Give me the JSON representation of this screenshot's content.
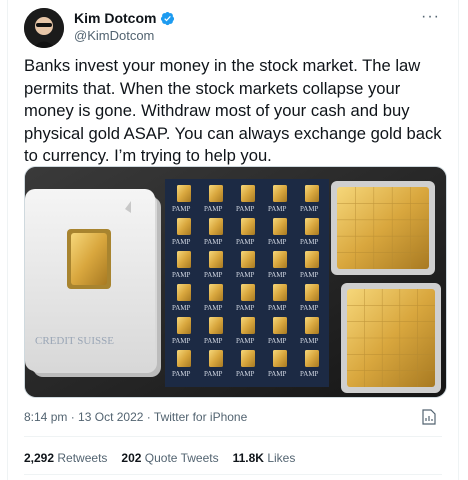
{
  "author": {
    "name": "Kim Dotcom",
    "handle": "@KimDotcom",
    "verified_icon": "verified-badge-icon"
  },
  "more_label": "···",
  "tweet": {
    "text": "Banks invest your money in the stock market. The law permits that. When the stock markets collapse your money is gone. Withdraw most of your cash and buy physical gold ASAP. You can always exchange gold back to currency. I’m trying to help you."
  },
  "media": {
    "brand_text": "CREDIT SUISSE",
    "bar_stamp": "PAMP"
  },
  "meta": {
    "time": "8:14 pm",
    "date": "13 Oct 2022",
    "source": "Twitter for iPhone",
    "separator": "·"
  },
  "stats": {
    "retweets_count": "2,292",
    "retweets_label": "Retweets",
    "quotes_count": "202",
    "quotes_label": "Quote Tweets",
    "likes_count": "11.8K",
    "likes_label": "Likes"
  },
  "colors": {
    "verified": "#1d9bf0",
    "gold": "#d9a73e",
    "text_secondary": "#536471"
  }
}
